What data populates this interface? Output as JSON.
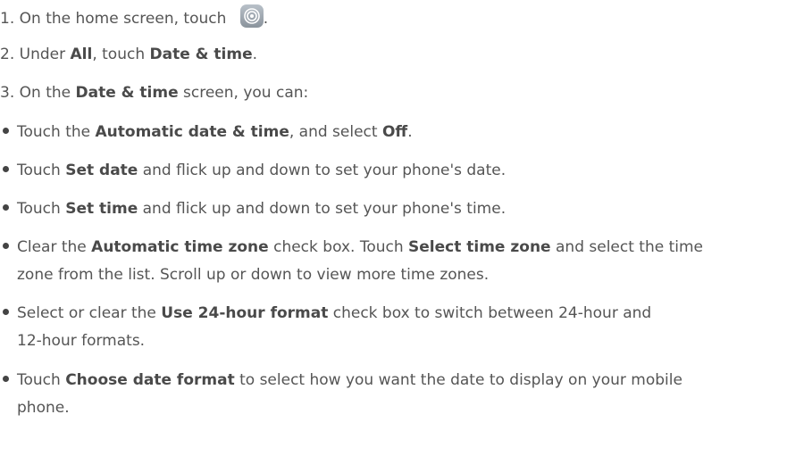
{
  "steps": [
    {
      "num": "1.",
      "text_before": "On the home screen, touch",
      "text_after": "."
    },
    {
      "num": "2.",
      "a": "Under ",
      "b1": "All",
      "c": ", touch ",
      "b2": "Date & time",
      "d": "."
    },
    {
      "num": "3.",
      "a": "On the ",
      "b1": "Date & time",
      "c": " screen, you can:"
    }
  ],
  "icon": {
    "name": "settings-gear-icon"
  },
  "bullets": [
    {
      "a": "Touch the ",
      "b1": "Automatic date & time",
      "c": ", and select ",
      "b2": "Off",
      "d": "."
    },
    {
      "a": "Touch ",
      "b1": "Set date",
      "c": " and flick up and down to set your phone's date."
    },
    {
      "a": "Touch ",
      "b1": "Set time",
      "c": " and flick up and down to set your phone's time."
    },
    {
      "a": "Clear the ",
      "b1": "Automatic time zone",
      "c": " check box. Touch ",
      "b2": "Select time zone",
      "d": " and select the time",
      "cont": "zone from the list. Scroll up or down to view more time zones."
    },
    {
      "a": "Select or clear the ",
      "b1": "Use 24-hour format",
      "c": " check box to switch between 24-hour and",
      "cont": "12-hour formats."
    },
    {
      "a": "Touch ",
      "b1": "Choose date format",
      "c": " to select how you want the date to display on your mobile",
      "cont": "phone."
    }
  ]
}
